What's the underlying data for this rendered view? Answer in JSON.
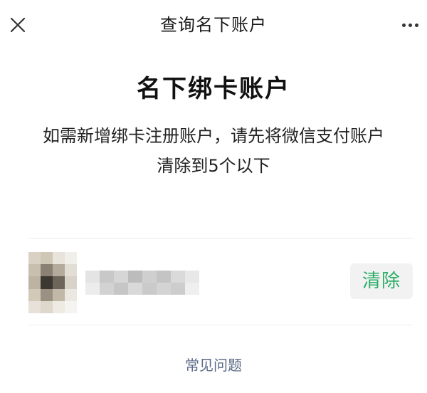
{
  "navbar": {
    "title": "查询名下账户",
    "close_icon": "close-icon",
    "more_icon": "more-icon"
  },
  "main": {
    "heading": "名下绑卡账户",
    "description_line1": "如需新增绑卡注册账户，请先将微信支付账户",
    "description_line2": "清除到5个以下"
  },
  "accounts": [
    {
      "avatar_icon": "blurred-avatar",
      "name": "",
      "clear_label": "清除"
    }
  ],
  "footer": {
    "faq_label": "常见问题"
  },
  "colors": {
    "accent_green": "#2aae67",
    "link_blue_gray": "#5a6a86",
    "button_bg": "#f2f2f2"
  }
}
